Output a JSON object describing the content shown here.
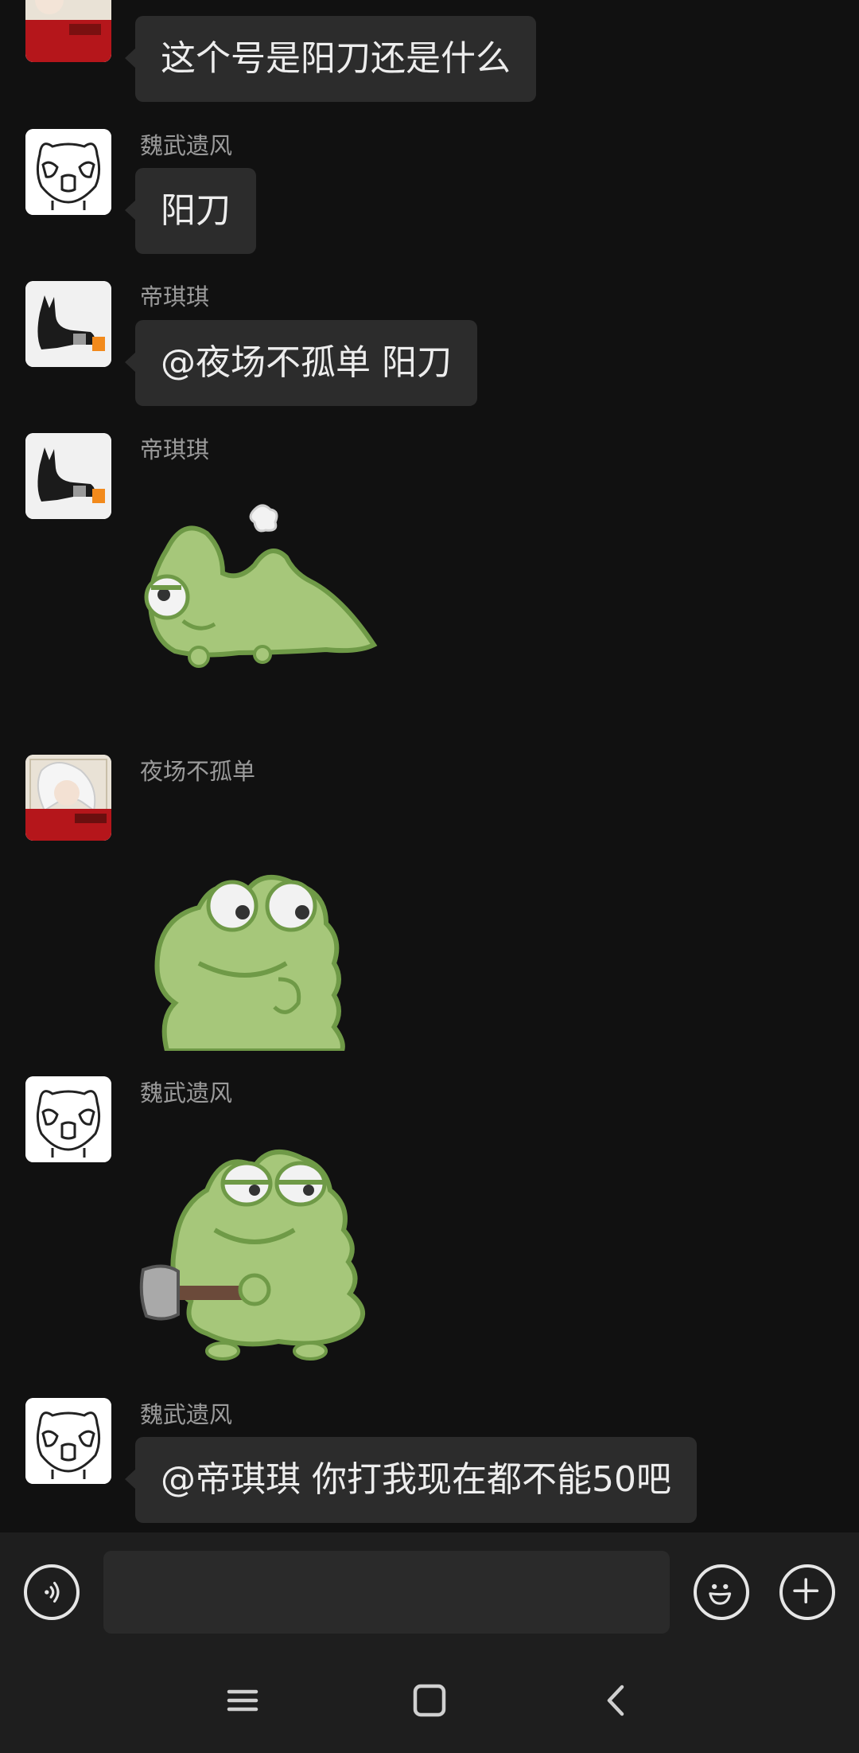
{
  "messages": [
    {
      "sender": "",
      "text": "这个号是阳刀还是什么"
    },
    {
      "sender": "魏武遗风",
      "text": "阳刀"
    },
    {
      "sender": "帝琪琪",
      "text": "@夜场不孤单  阳刀"
    },
    {
      "sender": "帝琪琪",
      "sticker": "frog-lying-sticker"
    },
    {
      "sender": "夜场不孤单",
      "sticker": "frog-smiling-sticker"
    },
    {
      "sender": "魏武遗风",
      "sticker": "frog-axe-sticker"
    },
    {
      "sender": "魏武遗风",
      "text": "@帝琪琪  你打我现在都不能50吧"
    }
  ],
  "input": {
    "value": "",
    "placeholder": ""
  },
  "icons": {
    "voice": "voice-icon",
    "emoji": "emoji-icon",
    "plus": "plus-icon",
    "nav_menu": "menu-icon",
    "nav_home": "home-icon",
    "nav_back": "back-icon"
  },
  "colors": {
    "background": "#111111",
    "bubble": "#2c2c2c",
    "sender_name": "#9b9b9b",
    "frog_green": "#a6c77a",
    "frog_outline": "#6f9a47"
  }
}
